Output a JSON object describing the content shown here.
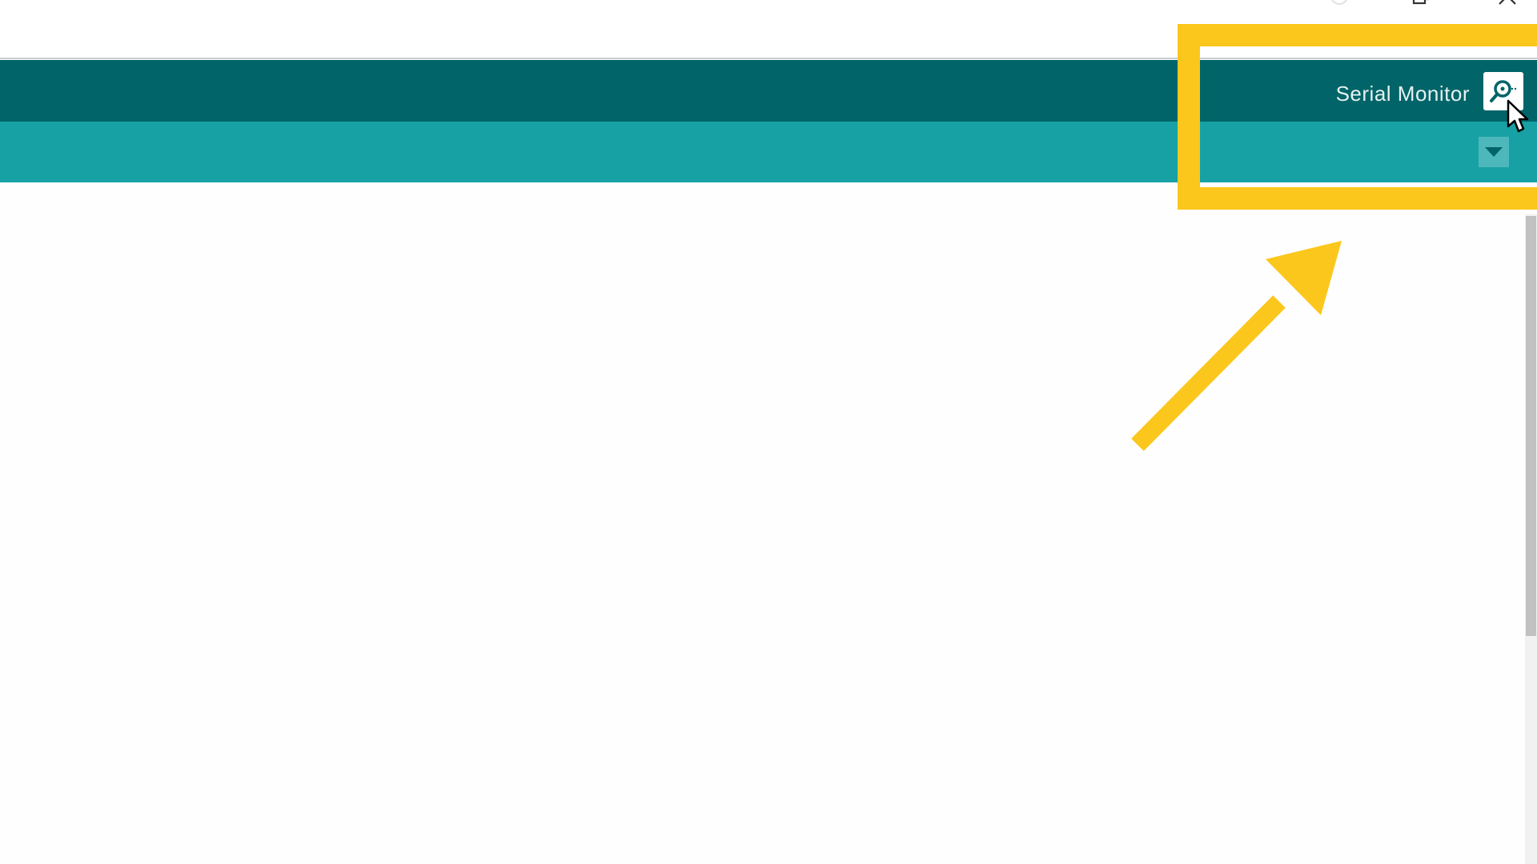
{
  "toolbar": {
    "serial_monitor_label": "Serial Monitor",
    "serial_monitor_icon": "serial-monitor-magnifier-icon"
  },
  "tabstrip": {
    "menu_icon": "triangle-down-icon"
  },
  "window_controls": [
    "minimize-icon",
    "maximize-icon",
    "close-icon"
  ],
  "annotation": {
    "highlight_color": "#fcc71c",
    "arrow_color": "#fcc71c"
  },
  "colors": {
    "toolbar": "#006468",
    "tabstrip": "#17a1a5",
    "editor_background": "#fefefe"
  }
}
